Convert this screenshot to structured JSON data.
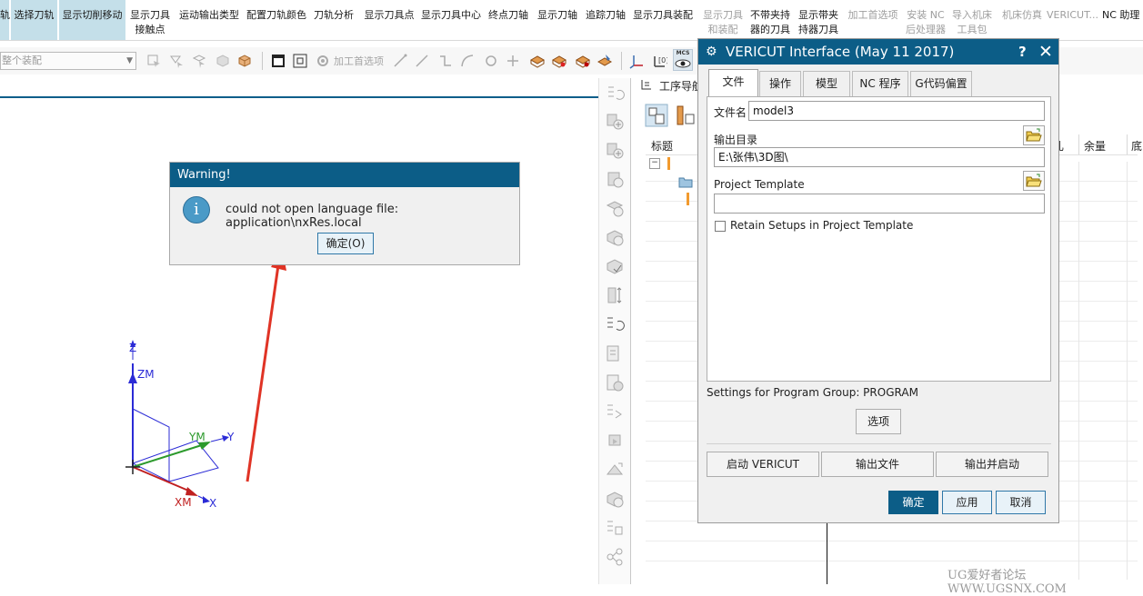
{
  "ribbon": {
    "items": [
      {
        "l1": "轨",
        "l2": "",
        "state": "sel"
      },
      {
        "l1": "选择刀轨",
        "l2": "",
        "state": "sel"
      },
      {
        "l1": "显示切削移动",
        "l2": "",
        "state": "sel"
      },
      {
        "l1": "显示刀具",
        "l2": "接触点",
        "state": ""
      },
      {
        "l1": "运动输出类型",
        "l2": "",
        "state": ""
      },
      {
        "l1": "配置刀轨颜色",
        "l2": "",
        "state": ""
      },
      {
        "l1": "刀轨分析",
        "l2": "",
        "state": ""
      },
      {
        "l1": "显示刀具点",
        "l2": "",
        "state": ""
      },
      {
        "l1": "显示刀具中心",
        "l2": "",
        "state": ""
      },
      {
        "l1": "终点刀轴",
        "l2": "",
        "state": ""
      },
      {
        "l1": "显示刀轴",
        "l2": "",
        "state": ""
      },
      {
        "l1": "追踪刀轴",
        "l2": "",
        "state": ""
      },
      {
        "l1": "显示刀具装配",
        "l2": "",
        "state": ""
      },
      {
        "l1": "显示刀具",
        "l2": "和装配",
        "state": "dis"
      },
      {
        "l1": "不带夹持",
        "l2": "器的刀具",
        "state": ""
      },
      {
        "l1": "显示带夹",
        "l2": "持器刀具",
        "state": ""
      },
      {
        "l1": "加工首选项",
        "l2": "",
        "state": "dis"
      },
      {
        "l1": "安装 NC",
        "l2": "后处理器",
        "state": "dis"
      },
      {
        "l1": "导入机床",
        "l2": "工具包",
        "state": "dis"
      },
      {
        "l1": "机床仿真",
        "l2": "",
        "state": "dis"
      },
      {
        "l1": "VERICUT...",
        "l2": "",
        "state": "dis"
      },
      {
        "l1": "NC 助理",
        "l2": "",
        "state": ""
      }
    ]
  },
  "toolbar2": {
    "assembly_filter": "整个装配",
    "machining_prefs": "加工首选项",
    "mcs_label": "MCS"
  },
  "navigator": {
    "title": "工序导航",
    "columns": [
      "标题",
      "余量",
      "底"
    ],
    "partial_column": "轧"
  },
  "axes": {
    "z": "Z",
    "zm": "ZM",
    "ym": "YM",
    "y": "Y",
    "xm": "XM",
    "x": "X"
  },
  "warning": {
    "title": "Warning!",
    "message": "could not open language file: application\\nxRes.local",
    "ok_label": "确定(O)"
  },
  "vericut": {
    "title": "VERICUT Interface (May 11 2017)",
    "help": "?",
    "tabs": [
      "文件",
      "操作",
      "模型",
      "NC 程序",
      "G代码偏置"
    ],
    "active_tab": "文件",
    "file_name_label": "文件名",
    "file_name_value": "model3",
    "output_dir_label": "输出目录",
    "output_dir_value": "E:\\张伟\\3D图\\",
    "project_template_label": "Project Template",
    "project_template_value": "",
    "retain_setups_label": "Retain Setups in Project Template",
    "retain_setups_checked": false,
    "settings_text": "Settings for Program Group: PROGRAM",
    "options_label": "选项",
    "start_label": "启动 VERICUT",
    "output_file_label": "输出文件",
    "output_start_label": "输出并启动",
    "ok_label": "确定",
    "apply_label": "应用",
    "cancel_label": "取消"
  },
  "watermark": "UG爱好者论坛 WWW.UGSNX.COM",
  "colors": {
    "dialog_header": "#0c5d87",
    "arrow_red": "#e03325",
    "ribbon_selected": "#c4dfe9"
  }
}
